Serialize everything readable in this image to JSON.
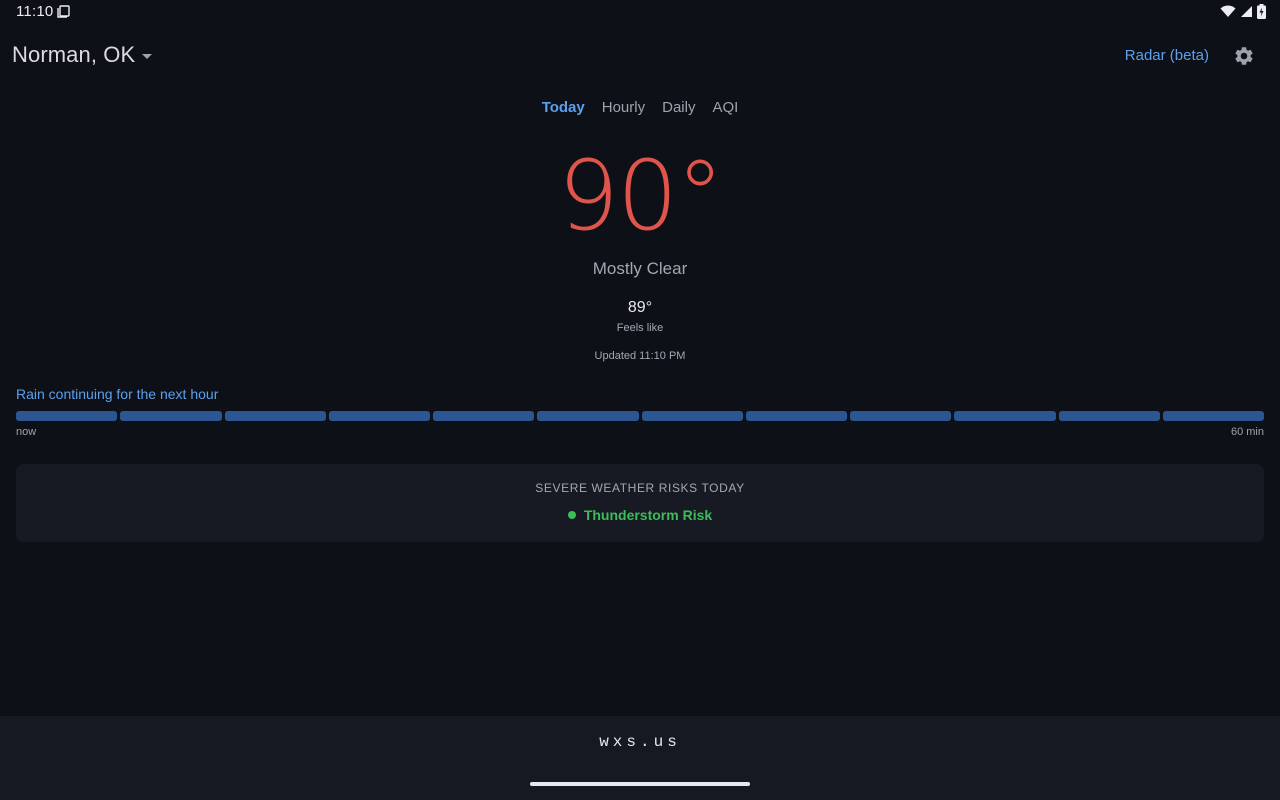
{
  "status_bar": {
    "time": "11:10",
    "icons": [
      "notification-icon",
      "wifi-icon",
      "signal-icon",
      "battery-charging-icon"
    ]
  },
  "header": {
    "location": "Norman, OK",
    "radar_link": "Radar (beta)",
    "settings_icon": "gear-icon"
  },
  "tabs": [
    {
      "label": "Today",
      "active": true
    },
    {
      "label": "Hourly",
      "active": false
    },
    {
      "label": "Daily",
      "active": false
    },
    {
      "label": "AQI",
      "active": false
    }
  ],
  "current": {
    "temperature": "90°",
    "condition": "Mostly Clear",
    "feels_like_value": "89°",
    "feels_like_label": "Feels like",
    "updated": "Updated 11:10 PM"
  },
  "precipitation": {
    "headline": "Rain continuing for the next hour",
    "segments": 12,
    "start_label": "now",
    "end_label": "60 min"
  },
  "severe": {
    "title": "SEVERE WEATHER RISKS TODAY",
    "risk_label": "Thunderstorm Risk"
  },
  "footer": {
    "brand": "wxs.us"
  },
  "colors": {
    "background": "#0e1017",
    "accent": "#5aa0ee",
    "temperature": "#e0554b",
    "risk": "#3bbd5a",
    "rain_bar": "#2b5692"
  }
}
